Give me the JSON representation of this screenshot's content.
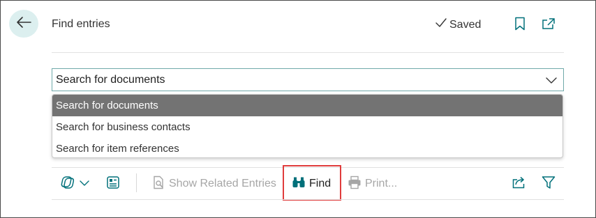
{
  "header": {
    "title": "Find entries",
    "saved_label": "Saved"
  },
  "search": {
    "selected_value": "Search for documents",
    "options": [
      "Search for documents",
      "Search for business contacts",
      "Search for item references"
    ]
  },
  "actions": {
    "show_related_entries": "Show Related Entries",
    "find": "Find",
    "print": "Print..."
  },
  "colors": {
    "accent_teal": "#00707a",
    "back_button_bg": "#dcefef",
    "selected_option_bg": "#737373",
    "highlight_box": "#e03c3c"
  },
  "icons": {
    "back": "arrow-left-icon",
    "saved": "checkmark-icon",
    "bookmark": "bookmark-icon",
    "popout": "open-in-new-window-icon",
    "chevron": "chevron-down-icon",
    "views": "views-icon",
    "page_layout": "page-layout-icon",
    "show_related": "document-search-icon",
    "find": "binoculars-icon",
    "print": "printer-icon",
    "share": "share-icon",
    "filter": "filter-icon"
  }
}
